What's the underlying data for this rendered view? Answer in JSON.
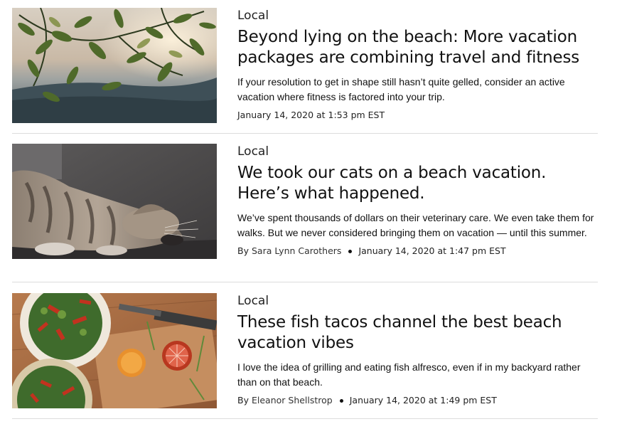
{
  "articles": [
    {
      "section": "Local",
      "headline": "Beyond lying on the beach: More vacation packages are combining travel and fitness",
      "blurb": "If your resolution to get in shape still hasn’t quite gelled, consider an active vacation where fitness is factored into your trip.",
      "byline_prefix": "",
      "author": "",
      "timestamp": "January 14, 2020 at 1:53 pm EST",
      "image_subject": "leaves-sunset-photo"
    },
    {
      "section": "Local",
      "headline": "We took our cats on a beach vacation. Here’s what happened.",
      "blurb": "We’ve spent thousands of dollars on their veterinary care. We even take them for walks. But we never considered bringing them on vacation — until this summer.",
      "byline_prefix": "By",
      "author": "Sara Lynn Carothers",
      "timestamp": "January 14, 2020 at 1:47 pm EST",
      "image_subject": "sleeping-cat-photo"
    },
    {
      "section": "Local",
      "headline": "These fish tacos channel the best beach vacation vibes",
      "blurb": "I love the idea of grilling and eating fish alfresco, even if in my backyard rather than on that beach.",
      "byline_prefix": "By",
      "author": "Eleanor Shellstrop",
      "timestamp": "January 14, 2020 at 1:49 pm EST",
      "image_subject": "salad-bowls-photo"
    }
  ]
}
